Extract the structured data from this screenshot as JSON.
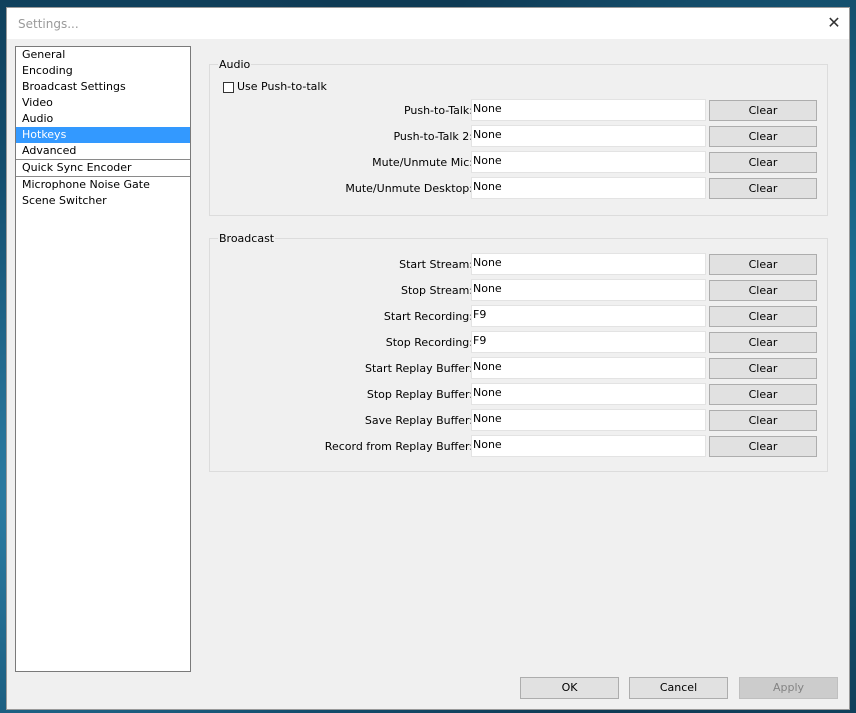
{
  "window": {
    "title": "Settings...",
    "close_glyph": "✕"
  },
  "sidebar": {
    "items": [
      {
        "label": "General",
        "selected": false
      },
      {
        "label": "Encoding",
        "selected": false
      },
      {
        "label": "Broadcast Settings",
        "selected": false
      },
      {
        "label": "Video",
        "selected": false
      },
      {
        "label": "Audio",
        "selected": false
      },
      {
        "label": "Hotkeys",
        "selected": true
      },
      {
        "label": "Advanced",
        "selected": false
      },
      {
        "label": "Quick Sync Encoder",
        "selected": false
      },
      {
        "label": "Microphone Noise Gate",
        "selected": false
      },
      {
        "label": "Scene Switcher",
        "selected": false
      }
    ]
  },
  "audio": {
    "title": "Audio",
    "push_to_talk_label": "Use Push-to-talk",
    "push_to_talk_checked": false,
    "rows": [
      {
        "label": "Push-to-Talk:",
        "value": "None",
        "button": "Clear"
      },
      {
        "label": "Push-to-Talk 2:",
        "value": "None",
        "button": "Clear"
      },
      {
        "label": "Mute/Unmute Mic:",
        "value": "None",
        "button": "Clear"
      },
      {
        "label": "Mute/Unmute Desktop:",
        "value": "None",
        "button": "Clear"
      }
    ]
  },
  "broadcast": {
    "title": "Broadcast",
    "rows": [
      {
        "label": "Start Stream:",
        "value": "None",
        "button": "Clear"
      },
      {
        "label": "Stop Stream:",
        "value": "None",
        "button": "Clear"
      },
      {
        "label": "Start Recording:",
        "value": "F9",
        "button": "Clear"
      },
      {
        "label": "Stop Recording:",
        "value": "F9",
        "button": "Clear"
      },
      {
        "label": "Start Replay Buffer:",
        "value": "None",
        "button": "Clear"
      },
      {
        "label": "Stop Replay Buffer:",
        "value": "None",
        "button": "Clear"
      },
      {
        "label": "Save Replay Buffer:",
        "value": "None",
        "button": "Clear"
      },
      {
        "label": "Record from Replay Buffer:",
        "value": "None",
        "button": "Clear"
      }
    ]
  },
  "footer": {
    "ok": "OK",
    "cancel": "Cancel",
    "apply": "Apply"
  }
}
